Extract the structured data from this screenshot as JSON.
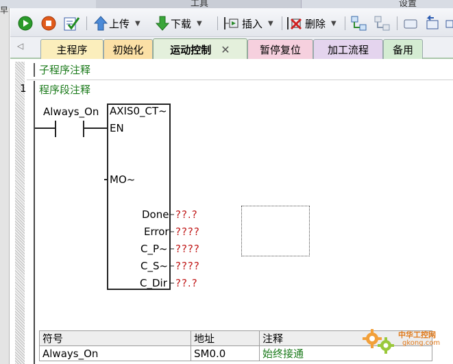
{
  "window": {
    "top_strip_labels": [
      "工具",
      "设置"
    ],
    "left_panel_glyph": "早"
  },
  "toolbar": {
    "buttons": [
      {
        "id": "run",
        "icon": "run-icon"
      },
      {
        "id": "stop",
        "icon": "stop-icon"
      },
      {
        "id": "compile",
        "icon": "compile-check-icon"
      },
      {
        "id": "upload",
        "icon": "upload-arrow-icon",
        "label": "上传"
      },
      {
        "id": "download",
        "icon": "download-arrow-icon",
        "label": "下载"
      },
      {
        "id": "insert",
        "icon": "insert-icon",
        "label": "插入"
      },
      {
        "id": "delete",
        "icon": "delete-icon",
        "label": "删除"
      },
      {
        "id": "network-view-1",
        "icon": "network-icon"
      },
      {
        "id": "network-view-2",
        "icon": "network-disabled-icon"
      },
      {
        "id": "box",
        "icon": "box-icon"
      },
      {
        "id": "back",
        "icon": "back-arrow-icon"
      },
      {
        "id": "more",
        "icon": "more-icon"
      }
    ],
    "dropdown_glyph": "▼"
  },
  "tabs": [
    {
      "label": "主程序",
      "color": "#fbeebc"
    },
    {
      "label": "初始化",
      "color": "#fbe0a6"
    },
    {
      "label": "运动控制",
      "color": "#e4f0dc",
      "active": true,
      "close": "✕"
    },
    {
      "label": "暂停复位",
      "color": "#f6d0de"
    },
    {
      "label": "加工流程",
      "color": "#e4d4ee"
    },
    {
      "label": "备用",
      "color": "#d4ecd2"
    }
  ],
  "editor": {
    "subroutine_comment": "子程序注释",
    "network_number": "1",
    "network_comment": "程序段注释",
    "contact": {
      "label": "Always_On"
    },
    "block": {
      "title": "AXIS0_CT~",
      "inputs": [
        "EN",
        "MO~"
      ],
      "outputs": [
        {
          "pin": "Done",
          "value": "??.?"
        },
        {
          "pin": "Error",
          "value": "????"
        },
        {
          "pin": "C_P~",
          "value": "????"
        },
        {
          "pin": "C_S~",
          "value": "????"
        },
        {
          "pin": "C_Dir",
          "value": "??.?"
        }
      ]
    },
    "symbol_table": {
      "headers": [
        "符号",
        "地址",
        "注释"
      ],
      "rows": [
        {
          "symbol": "Always_On",
          "address": "SM0.0",
          "comment": "始终接通"
        }
      ]
    }
  },
  "watermark": {
    "cn": "中华工控网",
    "en": "gkong.com"
  },
  "colors": {
    "comment_green": "#1a7a1a",
    "unassigned_red": "#c01818"
  }
}
